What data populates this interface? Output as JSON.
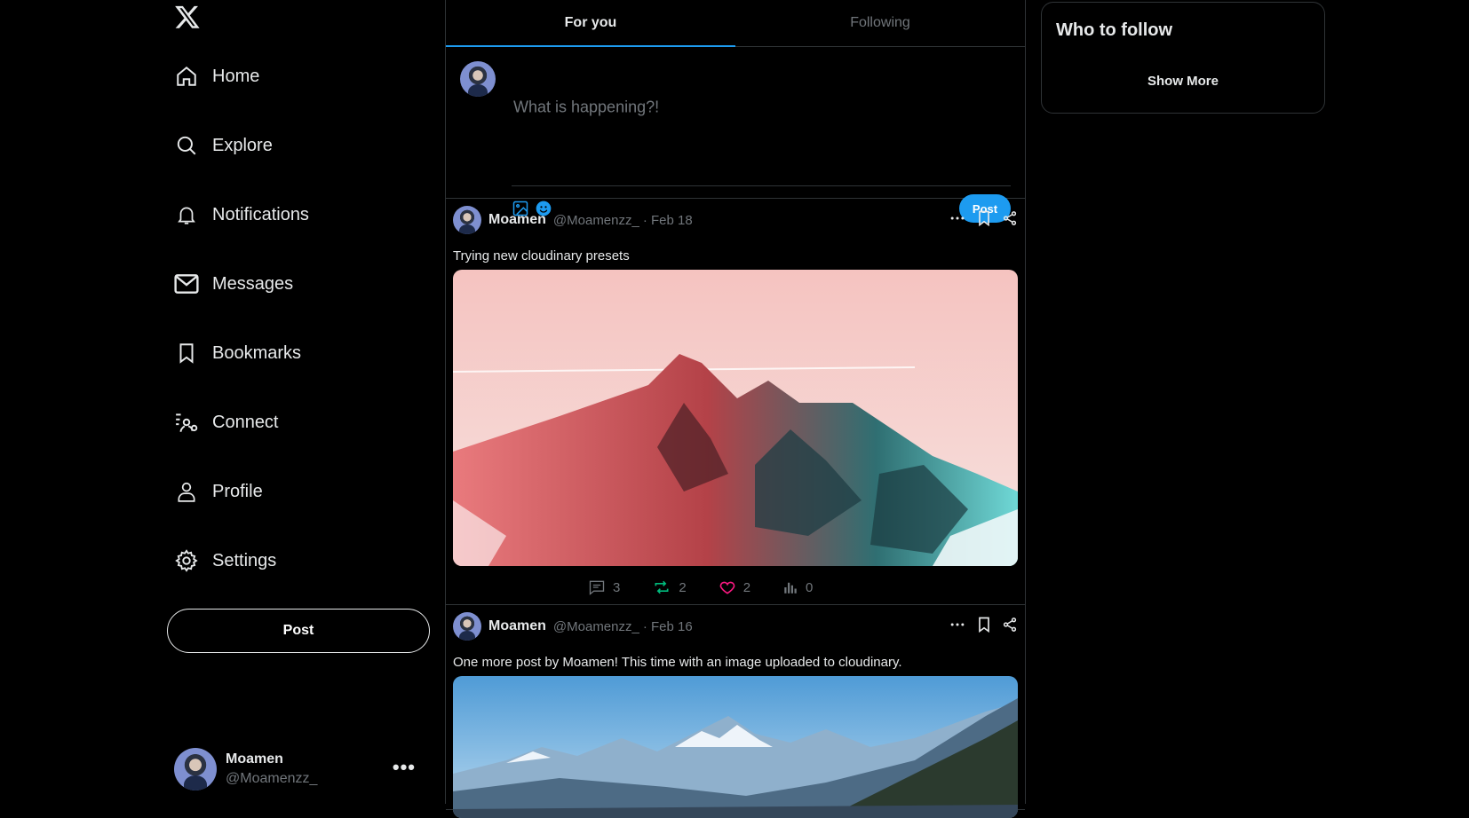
{
  "sidebar": {
    "logo": "x-logo",
    "items": [
      {
        "label": "Home",
        "icon": "home-icon"
      },
      {
        "label": "Explore",
        "icon": "search-icon"
      },
      {
        "label": "Notifications",
        "icon": "bell-icon"
      },
      {
        "label": "Messages",
        "icon": "mail-icon"
      },
      {
        "label": "Bookmarks",
        "icon": "bookmark-icon"
      },
      {
        "label": "Connect",
        "icon": "connect-icon"
      },
      {
        "label": "Profile",
        "icon": "user-icon"
      },
      {
        "label": "Settings",
        "icon": "gear-icon"
      }
    ],
    "post_label": "Post",
    "account": {
      "name": "Moamen",
      "handle": "@Moamenzz_",
      "more": "•••"
    }
  },
  "tabs": [
    {
      "label": "For you",
      "active": true
    },
    {
      "label": "Following",
      "active": false
    }
  ],
  "composer": {
    "placeholder": "What is happening?!",
    "post_label": "Post"
  },
  "tweets": [
    {
      "name": "Moamen",
      "handle": "@Moamenzz_",
      "date": "· Feb 18",
      "text": "Trying new cloudinary presets",
      "media": "pink-teal mountain photo",
      "stats": {
        "replies": "3",
        "retweets": "2",
        "likes": "2",
        "views": "0"
      }
    },
    {
      "name": "Moamen",
      "handle": "@Moamenzz_",
      "date": "· Feb 16",
      "text": "One more post by Moamen! This time with an image uploaded to cloudinary.",
      "media": "blue mountain valley photo"
    }
  ],
  "right": {
    "title": "Who to follow",
    "show_more": "Show More"
  },
  "colors": {
    "accent": "#1d9bf0",
    "retweet": "#00ba7c",
    "like": "#f91880",
    "muted": "#71767b"
  }
}
